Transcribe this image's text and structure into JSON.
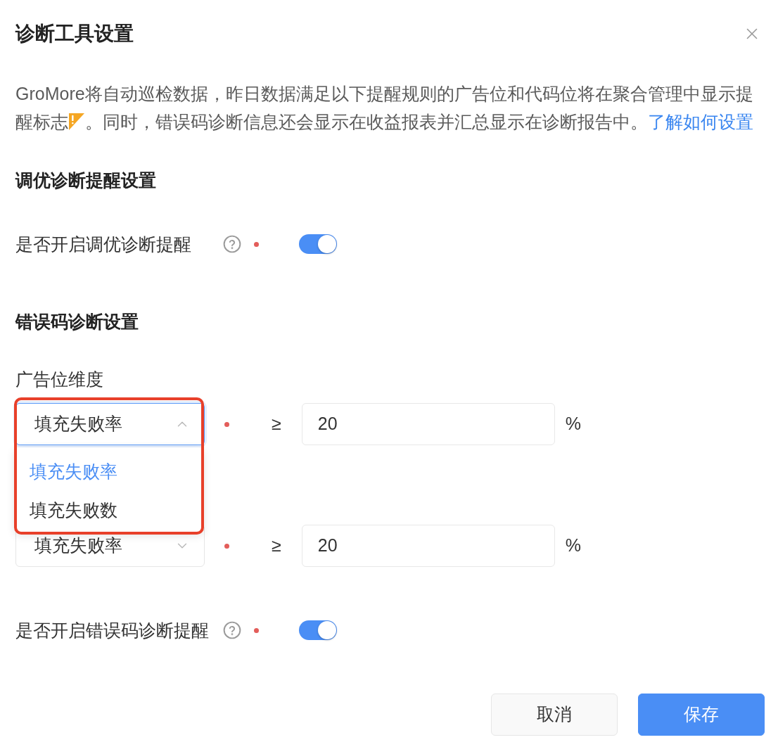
{
  "dialog": {
    "title": "诊断工具设置"
  },
  "intro": {
    "text_before_icon": "GroMore将自动巡检数据，昨日数据满足以下提醒规则的广告位和代码位将在聚合管理中显示提醒标志",
    "text_after_icon": "。同时，错误码诊断信息还会显示在收益报表并汇总显示在诊断报告中。",
    "link": "了解如何设置"
  },
  "sections": [
    {
      "title": "调优诊断提醒设置",
      "fields": [
        {
          "kind": "switch",
          "label": "是否开启调优诊断提醒",
          "required": true,
          "on": true
        }
      ]
    },
    {
      "title": "错误码诊断设置",
      "fields": [
        {
          "kind": "label",
          "label": "广告位维度"
        },
        {
          "kind": "threshold",
          "select": {
            "value": "填充失败率",
            "expanded": true,
            "options": [
              {
                "label": "填充失败率",
                "selected": true
              },
              {
                "label": "填充失败数",
                "selected": false
              }
            ]
          },
          "required": true,
          "operator": "≥",
          "value": "20",
          "unit": "%"
        },
        {
          "kind": "threshold",
          "select": {
            "value": "填充失败率",
            "expanded": false
          },
          "required": true,
          "operator": "≥",
          "value": "20",
          "unit": "%"
        },
        {
          "kind": "switch",
          "label": "是否开启错误码诊断提醒",
          "required": true,
          "on": true
        }
      ]
    }
  ],
  "buttons": [
    {
      "label": "取消",
      "kind": "secondary"
    },
    {
      "label": "保存",
      "kind": "primary"
    }
  ]
}
